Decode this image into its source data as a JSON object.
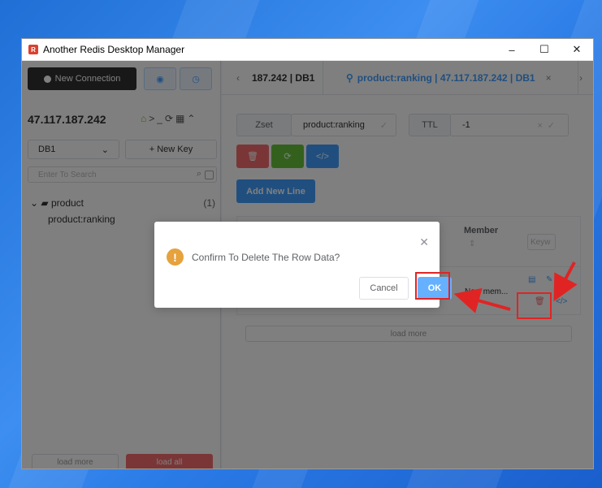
{
  "window": {
    "title": "Another Redis Desktop Manager",
    "minimize": "–",
    "maximize": "☐",
    "close": "✕"
  },
  "sidebar": {
    "new_connection": "New Connection",
    "connection_name": "47.117.187.242",
    "db_select": "DB1",
    "new_key": "+ New Key",
    "search_placeholder": "Enter To Search",
    "tree": {
      "folder": "product",
      "count": "(1)",
      "key": "product:ranking"
    },
    "load_more": "load more",
    "load_all": "load all"
  },
  "tabs": [
    {
      "label": "187.242 | DB1"
    },
    {
      "label": "product:ranking | 47.117.187.242 | DB1"
    }
  ],
  "key_detail": {
    "type": "Zset",
    "key_name": "product:ranking",
    "ttl_label": "TTL",
    "ttl_value": "-1",
    "add_new_line": "Add New Line",
    "column_member": "Member",
    "keyword_placeholder": "Keyw",
    "row_member": "New mem...",
    "load_more": "load more"
  },
  "dialog": {
    "message": "Confirm To Delete The Row Data?",
    "cancel": "Cancel",
    "ok": "OK"
  },
  "colors": {
    "accent": "#409eff",
    "danger": "#f56c6c",
    "success": "#67c23a",
    "warning": "#e6a23c",
    "annotation": "#e02424"
  }
}
